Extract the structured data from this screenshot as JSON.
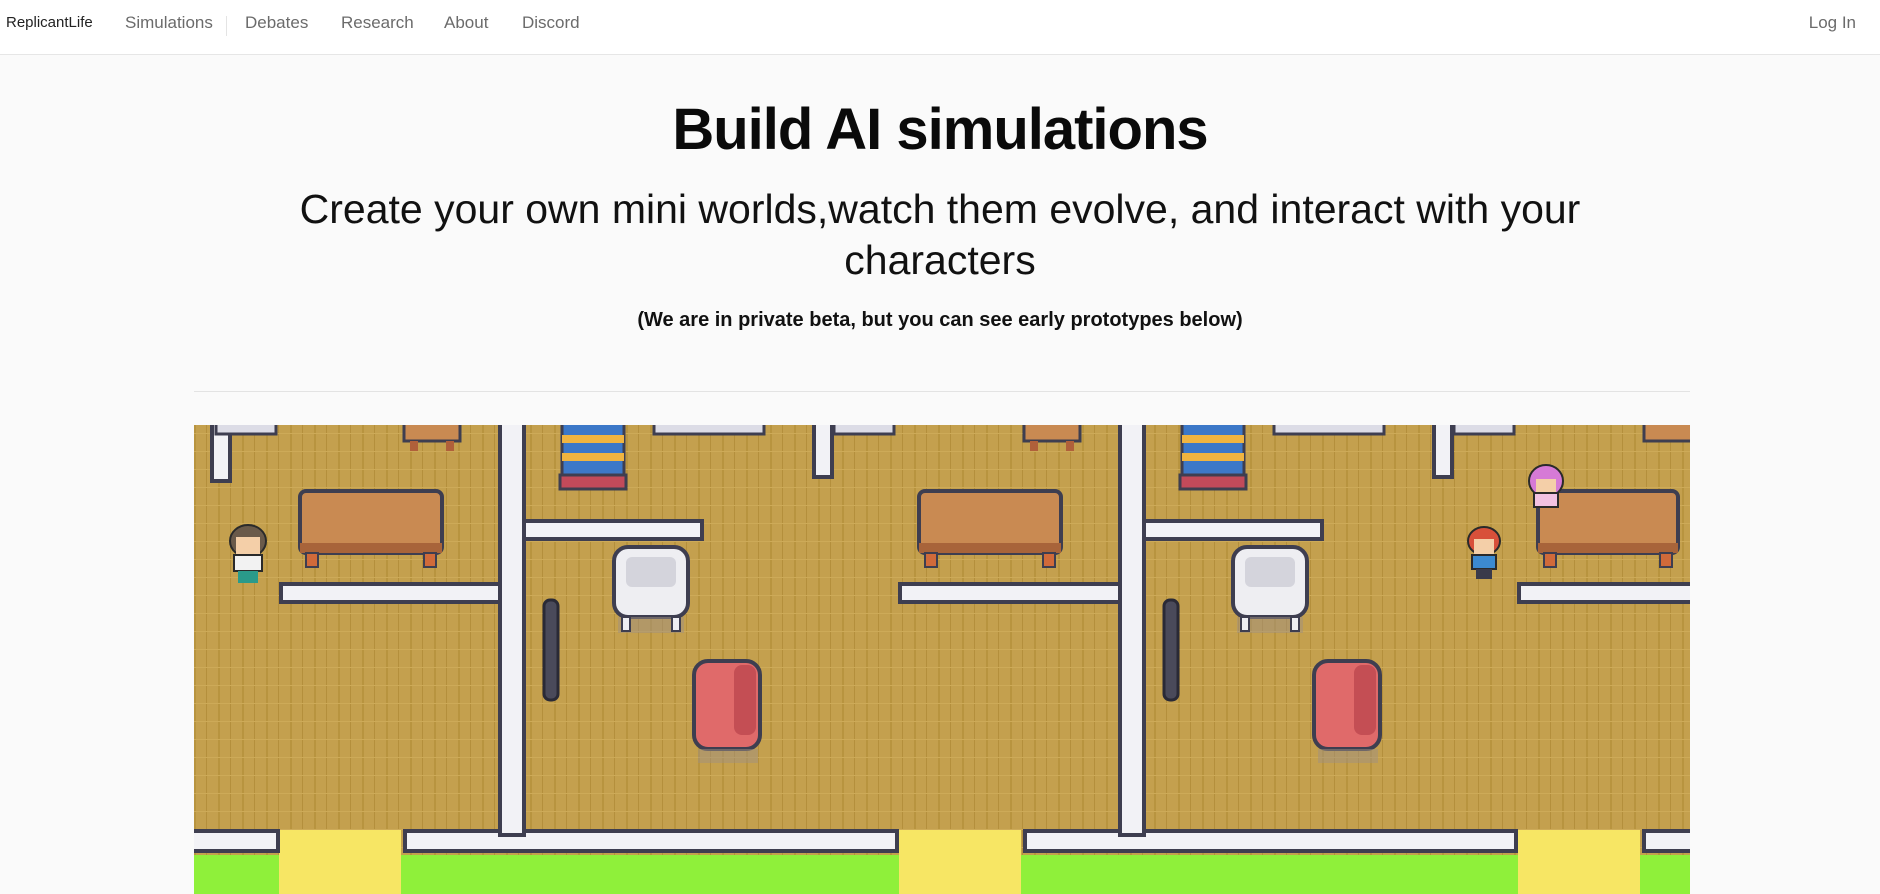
{
  "nav": {
    "brand": "ReplicantLife",
    "links": [
      "Simulations",
      "Debates",
      "Research",
      "About",
      "Discord"
    ],
    "login": "Log In"
  },
  "hero": {
    "title": "Build AI simulations",
    "subtitle": "Create your own mini worlds,watch them evolve, and interact with your characters",
    "note": "(We are in private beta, but you can see early prototypes below)"
  },
  "preview": {
    "description_icon": "pixel-art-game-map",
    "colors": {
      "floor": "#c4a04e",
      "wall": "#f2f2f6",
      "wall_outline": "#3e3e50",
      "grass": "#8ff03a",
      "sand": "#f7e664",
      "table": "#c98a52",
      "sofa_pink": "#e06a6a",
      "chair_white": "#eeeef2"
    }
  }
}
